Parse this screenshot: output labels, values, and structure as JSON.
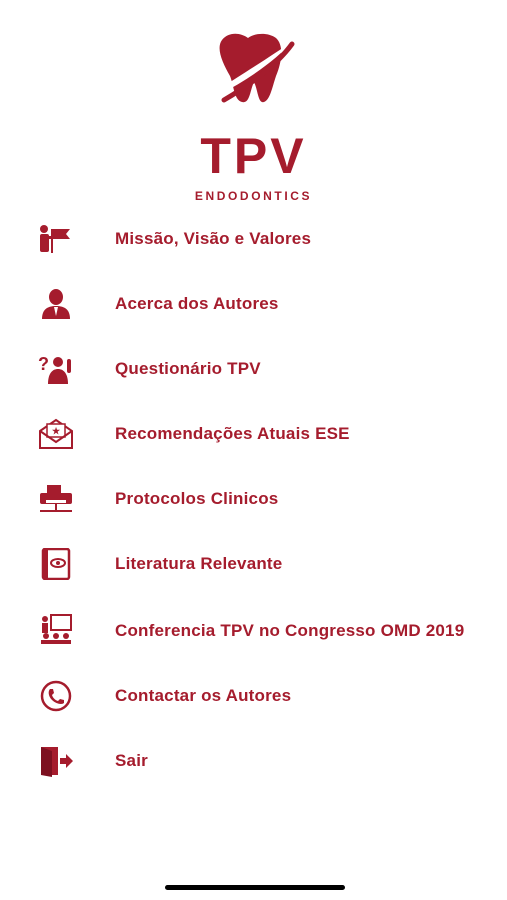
{
  "brand": {
    "name": "TPV",
    "subtitle": "ENDODONTICS",
    "color": "#A51C2D"
  },
  "menu": {
    "items": [
      {
        "label": "Missão, Visão e Valores",
        "icon": "presenter-flag-icon"
      },
      {
        "label": "Acerca dos Autores",
        "icon": "person-icon"
      },
      {
        "label": "Questionário TPV",
        "icon": "question-person-icon"
      },
      {
        "label": "Recomendações Atuais  ESE",
        "icon": "mail-envelope-icon"
      },
      {
        "label": "Protocolos Clinicos",
        "icon": "printer-network-icon"
      },
      {
        "label": "Literatura Relevante",
        "icon": "book-eye-icon"
      },
      {
        "label": "Conferencia TPV no Congresso OMD 2019",
        "icon": "conference-icon"
      },
      {
        "label": "Contactar os Autores",
        "icon": "phone-icon"
      },
      {
        "label": "Sair",
        "icon": "exit-door-icon"
      }
    ]
  }
}
